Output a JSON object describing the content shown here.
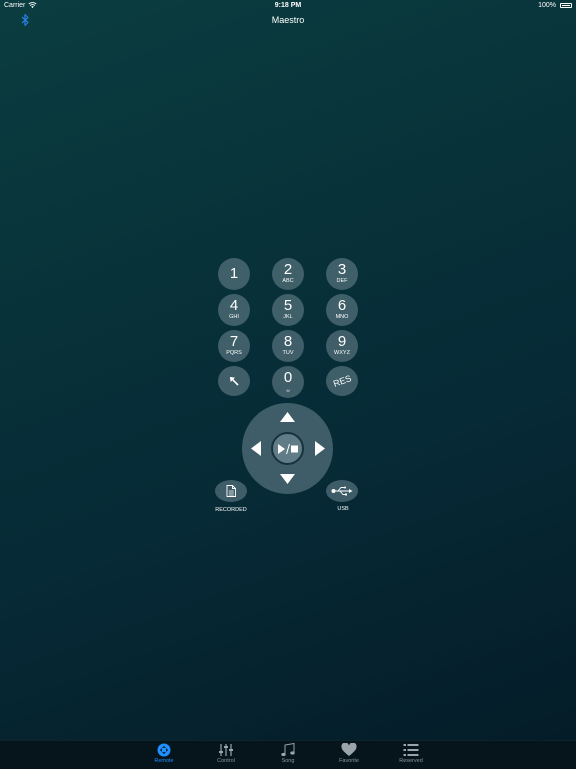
{
  "status": {
    "carrier": "Carrier",
    "time": "9:18 PM",
    "battery": "100%"
  },
  "nav": {
    "title": "Maestro"
  },
  "keypad": [
    {
      "num": "1",
      "sub": ""
    },
    {
      "num": "2",
      "sub": "ABC"
    },
    {
      "num": "3",
      "sub": "DEF"
    },
    {
      "num": "4",
      "sub": "GHI"
    },
    {
      "num": "5",
      "sub": "JKL"
    },
    {
      "num": "6",
      "sub": "MNO"
    },
    {
      "num": "7",
      "sub": "PQRS"
    },
    {
      "num": "8",
      "sub": "TUV"
    },
    {
      "num": "9",
      "sub": "WXYZ"
    },
    {
      "num": "0",
      "sub": "␣"
    }
  ],
  "res_label": "RES",
  "recorded_label": "RECORDED",
  "usb_label": "USB",
  "tabs": [
    {
      "label": "Remote",
      "icon": "remote-icon",
      "active": true
    },
    {
      "label": "Control",
      "icon": "sliders-icon",
      "active": false
    },
    {
      "label": "Song",
      "icon": "music-note-icon",
      "active": false
    },
    {
      "label": "Favorite",
      "icon": "heart-icon",
      "active": false
    },
    {
      "label": "Reserved",
      "icon": "list-icon",
      "active": false
    }
  ],
  "colors": {
    "accent": "#1e90ff",
    "bluetooth": "#2a7fe0"
  }
}
